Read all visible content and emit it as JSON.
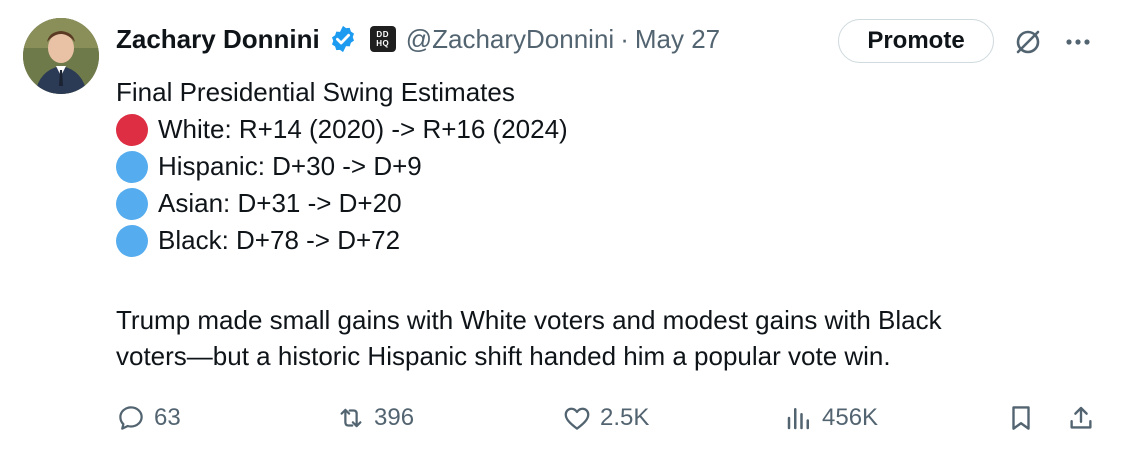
{
  "author": {
    "name": "Zachary Donnini",
    "affiliation_badge": "DDHQ",
    "handle": "@ZacharyDonnini",
    "separator": "·",
    "date": "May 27",
    "verified_color": "#1d9bf0"
  },
  "header": {
    "promote_label": "Promote"
  },
  "tweet": {
    "title": "Final Presidential Swing Estimates",
    "items": [
      {
        "dot": "red-circle",
        "dot_color": "#dd2e44",
        "text": "White: R+14 (2020) -> R+16 (2024)"
      },
      {
        "dot": "blue-circle",
        "dot_color": "#55acee",
        "text": "Hispanic: D+30 -> D+9"
      },
      {
        "dot": "blue-circle",
        "dot_color": "#55acee",
        "text": "Asian: D+31 -> D+20"
      },
      {
        "dot": "blue-circle",
        "dot_color": "#55acee",
        "text": "Black: D+78 -> D+72"
      }
    ],
    "paragraph_lines": [
      "Trump made small gains with White voters and modest gains with Black",
      "voters—but a historic Hispanic shift handed him a popular vote win."
    ]
  },
  "actions": {
    "replies": "63",
    "reposts": "396",
    "likes": "2.5K",
    "views": "456K"
  }
}
